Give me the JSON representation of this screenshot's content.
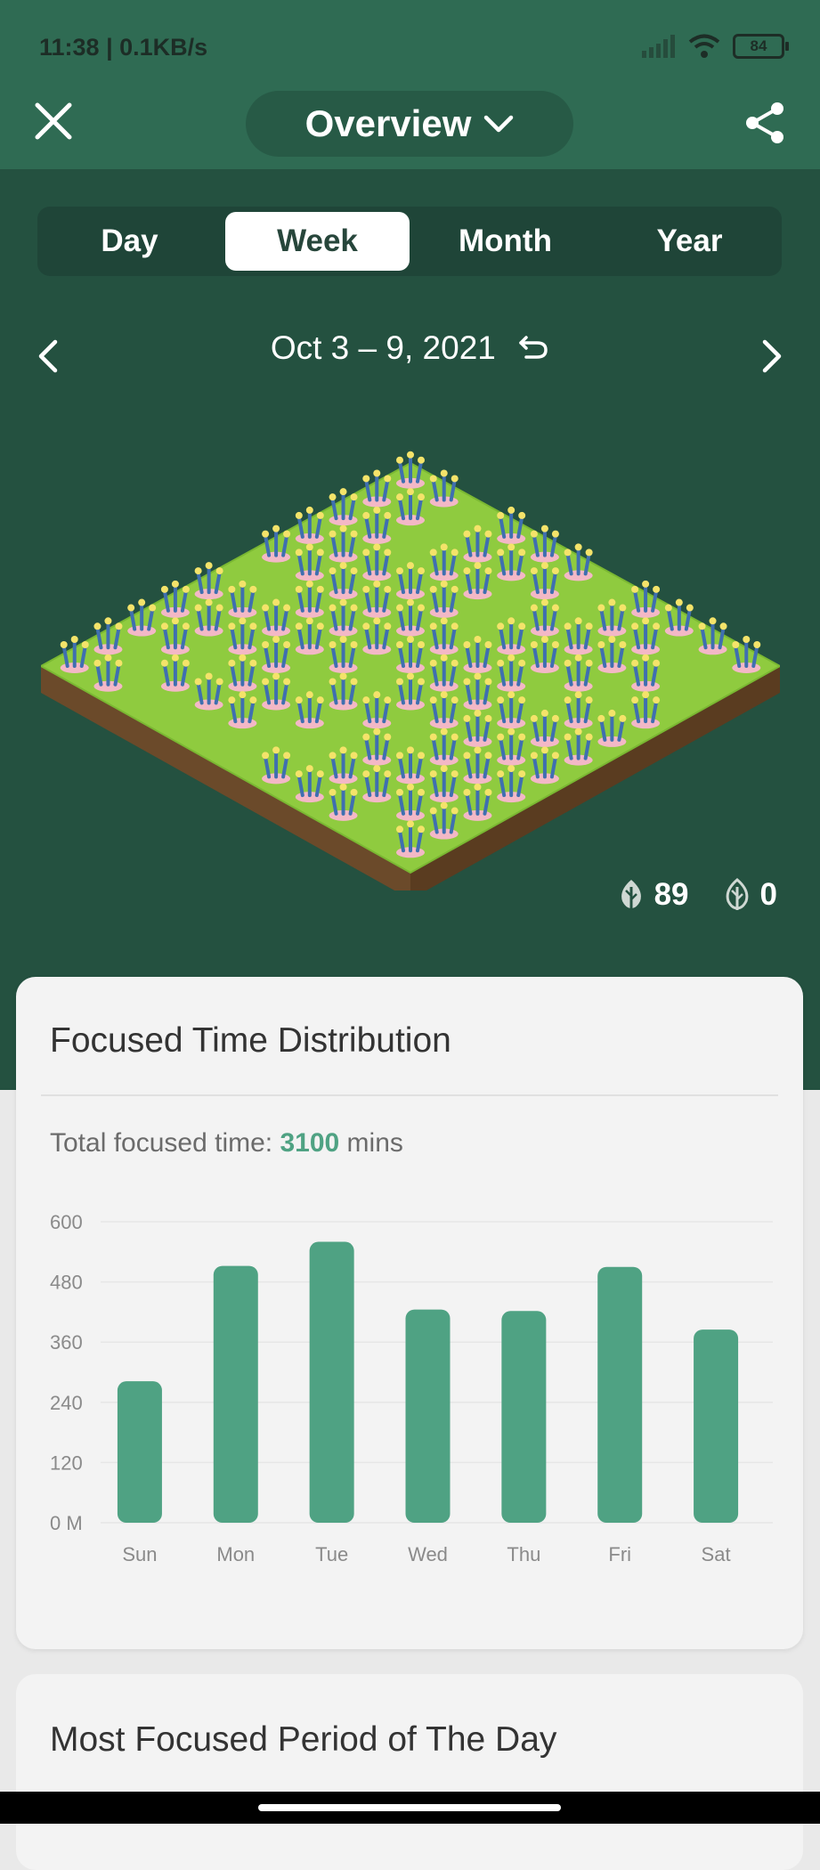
{
  "status": {
    "time_speed": "11:38 | 0.1KB/s",
    "battery": "84"
  },
  "header": {
    "title": "Overview"
  },
  "tabs": [
    {
      "label": "Day",
      "active": false
    },
    {
      "label": "Week",
      "active": true
    },
    {
      "label": "Month",
      "active": false
    },
    {
      "label": "Year",
      "active": false
    }
  ],
  "date_range": "Oct 3 – 9, 2021",
  "forest_counts": {
    "healthy": "89",
    "withered": "0"
  },
  "card": {
    "title": "Focused Time Distribution",
    "total_prefix": "Total focused time: ",
    "total_value": "3100",
    "total_suffix": " mins"
  },
  "chart_data": {
    "type": "bar",
    "categories": [
      "Sun",
      "Mon",
      "Tue",
      "Wed",
      "Thu",
      "Fri",
      "Sat"
    ],
    "values": [
      282,
      512,
      560,
      425,
      422,
      510,
      385
    ],
    "ylim": [
      0,
      600
    ],
    "yticks": [
      "0 M",
      "120",
      "240",
      "360",
      "480",
      "600"
    ],
    "bar_color": "#4fa283",
    "grid": true
  },
  "card2": {
    "title": "Most Focused Period of The Day"
  },
  "colors": {
    "header": "#2f6b53",
    "panel": "#245140",
    "accent": "#4fa283"
  },
  "icons": [
    "close-icon",
    "chevron-down-icon",
    "share-icon",
    "chevron-left-icon",
    "chevron-right-icon",
    "undo-icon",
    "tree-icon",
    "dead-tree-icon"
  ]
}
